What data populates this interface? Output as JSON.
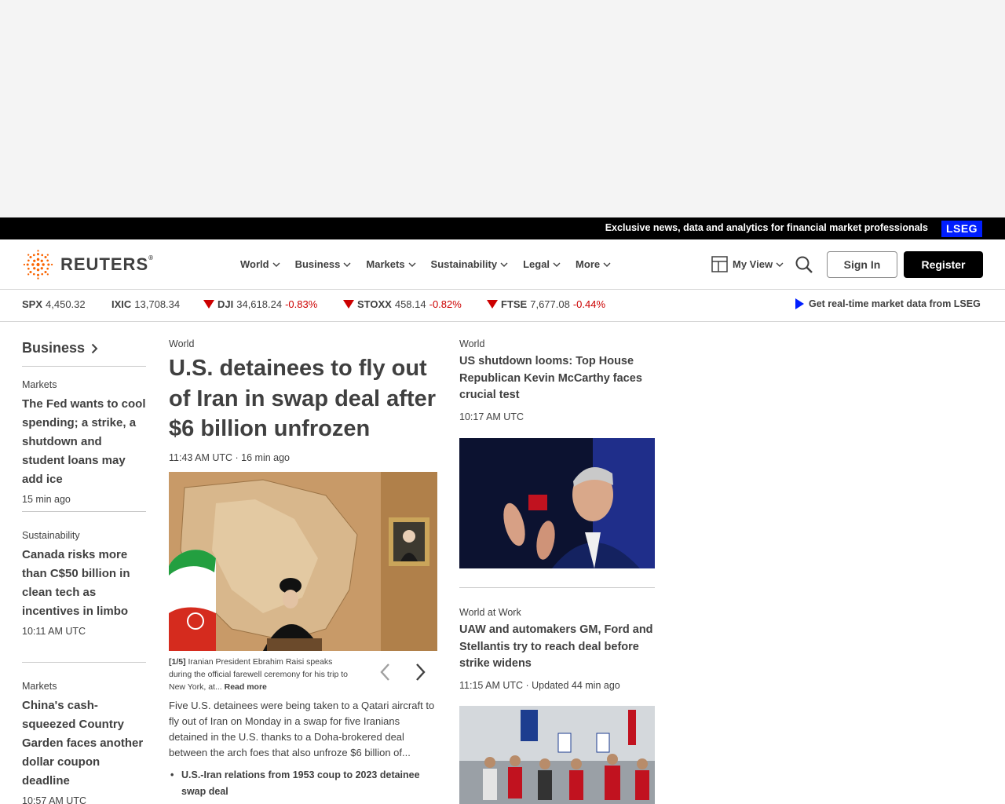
{
  "promo": {
    "text": "Exclusive news, data and analytics for financial market professionals",
    "badge": "LSEG"
  },
  "brand": {
    "name": "REUTERS",
    "reg": "®"
  },
  "nav": [
    "World",
    "Business",
    "Markets",
    "Sustainability",
    "Legal",
    "More"
  ],
  "header": {
    "myview": "My View",
    "signin": "Sign In",
    "register": "Register"
  },
  "ticker": [
    {
      "symbol": "SPX",
      "value": "4,450.32"
    },
    {
      "symbol": "IXIC",
      "value": "13,708.34"
    },
    {
      "symbol": "DJI",
      "value": "34,618.24",
      "change": "-0.83%"
    },
    {
      "symbol": "STOXX",
      "value": "458.14",
      "change": "-0.82%"
    },
    {
      "symbol": "FTSE",
      "value": "7,677.08",
      "change": "-0.44%"
    }
  ],
  "ticker_cta": "Get real-time market data from LSEG",
  "section": {
    "title": "Business"
  },
  "left_stories": [
    {
      "kicker": "Markets",
      "headline": "The Fed wants to cool spending; a strike, a shutdown and student loans may add ice",
      "time": "15 min ago"
    },
    {
      "kicker": "Sustainability",
      "headline": "Canada risks more than C$50 billion in clean tech as incentives in limbo",
      "time": "10:11 AM UTC"
    },
    {
      "kicker": "Markets",
      "headline": "China's cash-squeezed Country Garden faces another dollar coupon deadline",
      "time": "10:57 AM UTC"
    }
  ],
  "main": {
    "kicker": "World",
    "headline": "U.S. detainees to fly out of Iran in swap deal after $6 billion unfrozen",
    "time": "11:43 AM UTC · 16 min ago",
    "caption_index": "[1/5]",
    "caption": "Iranian President Ebrahim Raisi speaks during the official farewell ceremony for his trip to New York, at...",
    "caption_more": "Read more",
    "summary": "Five U.S. detainees were being taken to a Qatari aircraft to fly out of Iran on Monday in a swap for five Iranians detained in the U.S. thanks to a Doha-brokered deal between the arch foes that also unfroze $6 billion of...",
    "bullet": "U.S.-Iran relations from 1953 coup to 2023 detainee swap deal"
  },
  "right_stories": [
    {
      "kicker": "World",
      "headline": "US shutdown looms: Top House Republican Kevin McCarthy faces crucial test",
      "time": "10:17 AM UTC"
    },
    {
      "kicker": "World at Work",
      "headline": "UAW and automakers GM, Ford and Stellantis try to reach deal before strike widens",
      "time": "11:15 AM UTC · Updated 44 min ago"
    }
  ],
  "colors": {
    "accent": "#001eff",
    "negative": "#cc0000",
    "logo": "#fa6400"
  }
}
